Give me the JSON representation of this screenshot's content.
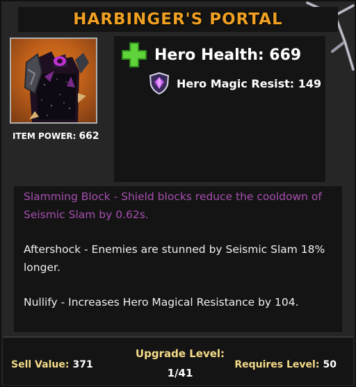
{
  "item": {
    "title": "HARBINGER'S PORTAL",
    "power_label": "ITEM POWER:",
    "power_value": "662"
  },
  "stats": {
    "health": "Hero Health: 669",
    "magic_resist": "Hero Magic Resist: 149"
  },
  "enchantments": [
    {
      "text": "Slamming Block - Shield blocks reduce the cooldown of Seismic Slam by 0.62s.",
      "color": "#a74fb0"
    },
    {
      "text": "Aftershock - Enemies are stunned by Seismic Slam 18% longer.",
      "color": "#f0f0f0"
    },
    {
      "text": "Nullify - Increases Hero Magical Resistance by 104.",
      "color": "#f0f0f0"
    }
  ],
  "footer": {
    "sell_label": "Sell Value:",
    "sell_value": "371",
    "upgrade_label": "Upgrade Level:",
    "upgrade_value": "1/41",
    "requires_label": "Requires Level:",
    "requires_value": "50"
  },
  "icons": {
    "health": "green-plus-icon",
    "magic_resist": "purple-gem-shield-icon",
    "item": "dark-armor-item-icon"
  },
  "colors": {
    "title": "#f0a022",
    "footer_label": "#f5dc8a",
    "enchant_highlight": "#a74fb0"
  }
}
